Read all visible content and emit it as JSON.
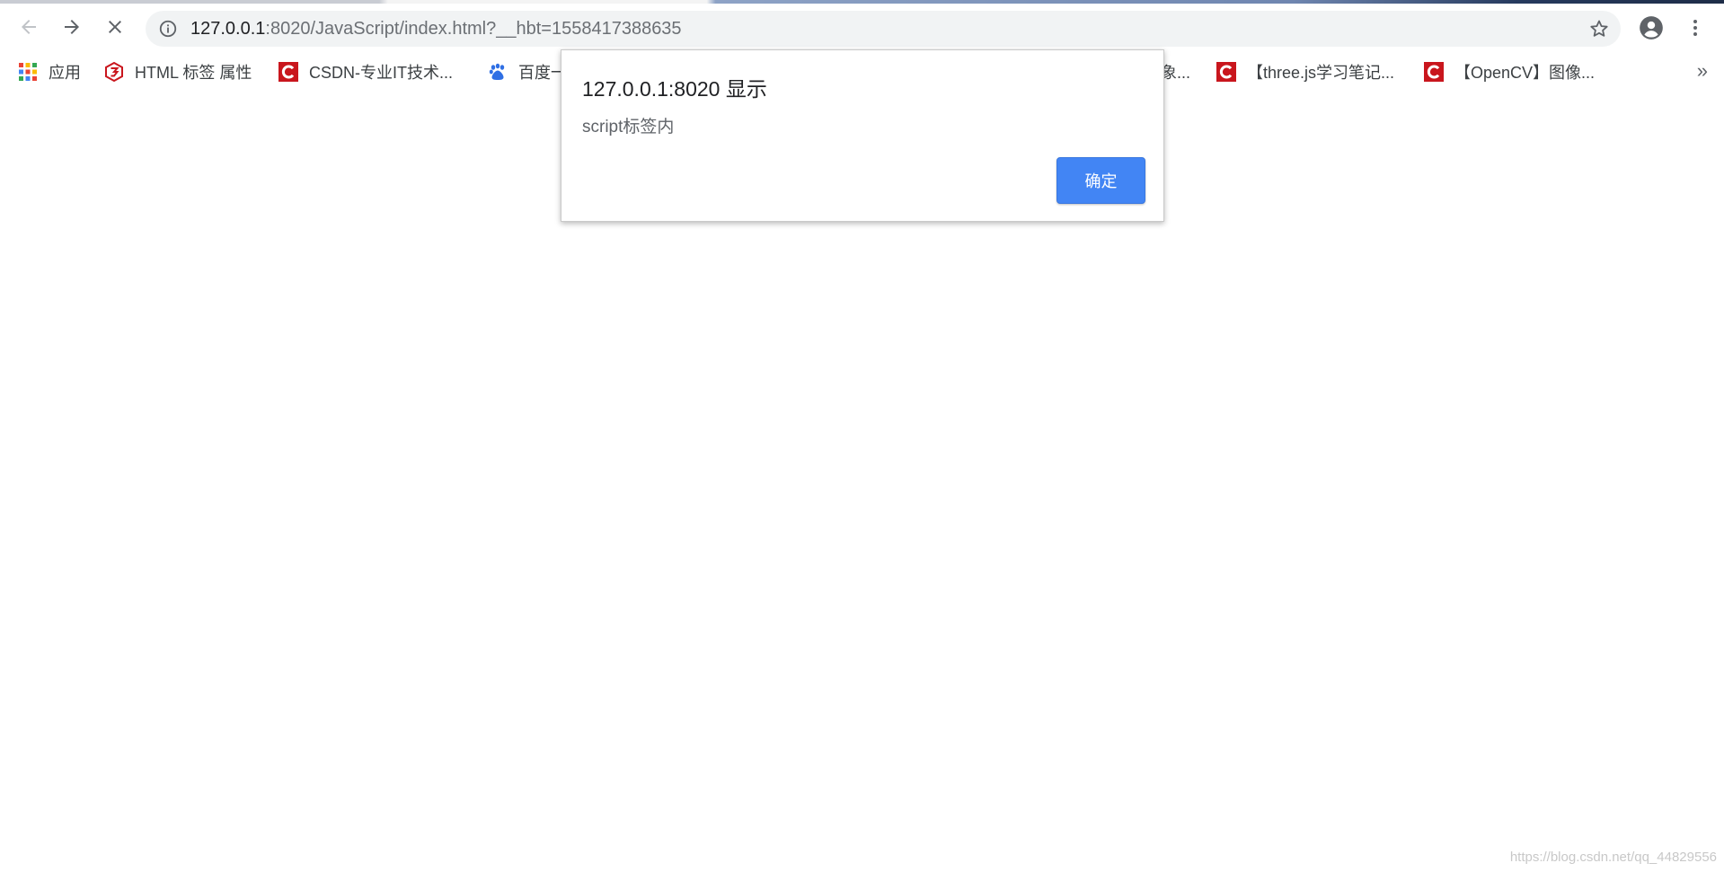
{
  "browser": {
    "url_host": "127.0.0.1",
    "url_rest": ":8020/JavaScript/index.html?__hbt=1558417388635"
  },
  "bookmarks": {
    "items": [
      {
        "label": "应用"
      },
      {
        "label": "HTML 标签 属性"
      },
      {
        "label": "CSDN-专业IT技术..."
      },
      {
        "label": "百度一"
      },
      {
        "label": "象..."
      },
      {
        "label": "【three.js学习笔记..."
      },
      {
        "label": "【OpenCV】图像..."
      }
    ],
    "more": "»"
  },
  "dialog": {
    "title": "127.0.0.1:8020 显示",
    "message": "script标签内",
    "ok_label": "确定"
  },
  "watermark": "https://blog.csdn.net/qq_44829556",
  "colors": {
    "accent": "#4285f4",
    "csdn_red": "#c9161d"
  }
}
